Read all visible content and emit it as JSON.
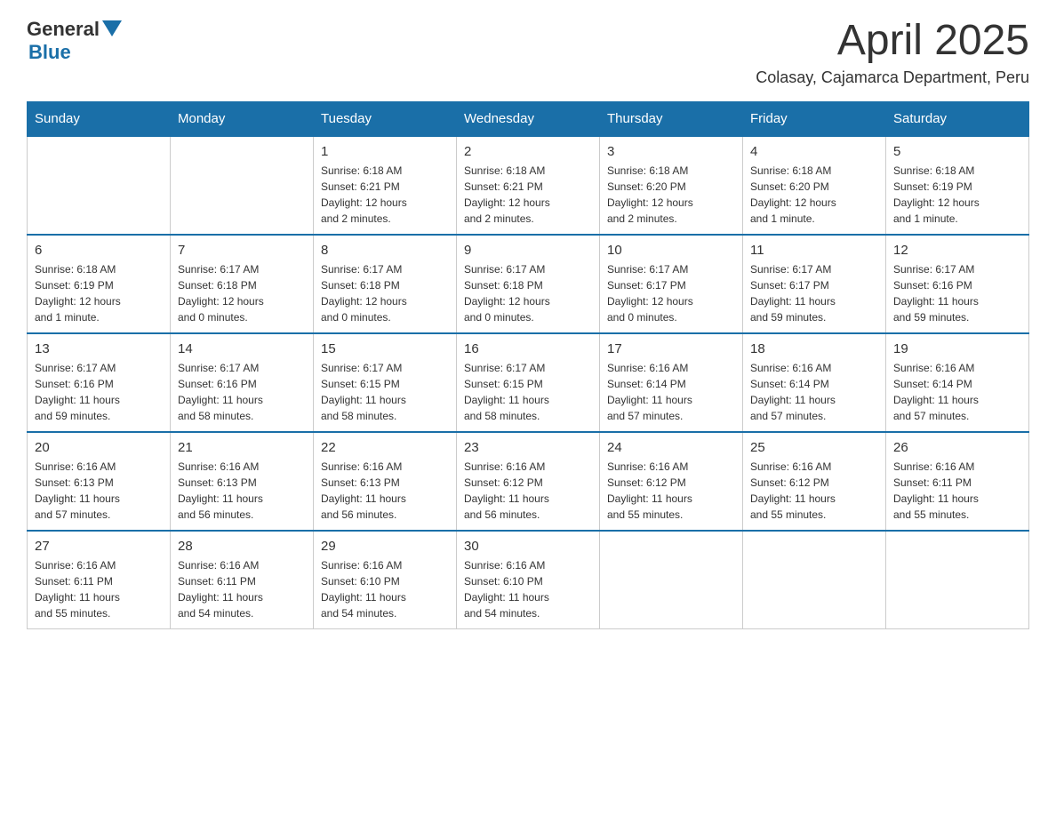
{
  "logo": {
    "text_general": "General",
    "text_blue": "Blue",
    "triangle": "▼"
  },
  "title": "April 2025",
  "subtitle": "Colasay, Cajamarca Department, Peru",
  "days_of_week": [
    "Sunday",
    "Monday",
    "Tuesday",
    "Wednesday",
    "Thursday",
    "Friday",
    "Saturday"
  ],
  "weeks": [
    [
      {
        "day": "",
        "info": ""
      },
      {
        "day": "",
        "info": ""
      },
      {
        "day": "1",
        "info": "Sunrise: 6:18 AM\nSunset: 6:21 PM\nDaylight: 12 hours\nand 2 minutes."
      },
      {
        "day": "2",
        "info": "Sunrise: 6:18 AM\nSunset: 6:21 PM\nDaylight: 12 hours\nand 2 minutes."
      },
      {
        "day": "3",
        "info": "Sunrise: 6:18 AM\nSunset: 6:20 PM\nDaylight: 12 hours\nand 2 minutes."
      },
      {
        "day": "4",
        "info": "Sunrise: 6:18 AM\nSunset: 6:20 PM\nDaylight: 12 hours\nand 1 minute."
      },
      {
        "day": "5",
        "info": "Sunrise: 6:18 AM\nSunset: 6:19 PM\nDaylight: 12 hours\nand 1 minute."
      }
    ],
    [
      {
        "day": "6",
        "info": "Sunrise: 6:18 AM\nSunset: 6:19 PM\nDaylight: 12 hours\nand 1 minute."
      },
      {
        "day": "7",
        "info": "Sunrise: 6:17 AM\nSunset: 6:18 PM\nDaylight: 12 hours\nand 0 minutes."
      },
      {
        "day": "8",
        "info": "Sunrise: 6:17 AM\nSunset: 6:18 PM\nDaylight: 12 hours\nand 0 minutes."
      },
      {
        "day": "9",
        "info": "Sunrise: 6:17 AM\nSunset: 6:18 PM\nDaylight: 12 hours\nand 0 minutes."
      },
      {
        "day": "10",
        "info": "Sunrise: 6:17 AM\nSunset: 6:17 PM\nDaylight: 12 hours\nand 0 minutes."
      },
      {
        "day": "11",
        "info": "Sunrise: 6:17 AM\nSunset: 6:17 PM\nDaylight: 11 hours\nand 59 minutes."
      },
      {
        "day": "12",
        "info": "Sunrise: 6:17 AM\nSunset: 6:16 PM\nDaylight: 11 hours\nand 59 minutes."
      }
    ],
    [
      {
        "day": "13",
        "info": "Sunrise: 6:17 AM\nSunset: 6:16 PM\nDaylight: 11 hours\nand 59 minutes."
      },
      {
        "day": "14",
        "info": "Sunrise: 6:17 AM\nSunset: 6:16 PM\nDaylight: 11 hours\nand 58 minutes."
      },
      {
        "day": "15",
        "info": "Sunrise: 6:17 AM\nSunset: 6:15 PM\nDaylight: 11 hours\nand 58 minutes."
      },
      {
        "day": "16",
        "info": "Sunrise: 6:17 AM\nSunset: 6:15 PM\nDaylight: 11 hours\nand 58 minutes."
      },
      {
        "day": "17",
        "info": "Sunrise: 6:16 AM\nSunset: 6:14 PM\nDaylight: 11 hours\nand 57 minutes."
      },
      {
        "day": "18",
        "info": "Sunrise: 6:16 AM\nSunset: 6:14 PM\nDaylight: 11 hours\nand 57 minutes."
      },
      {
        "day": "19",
        "info": "Sunrise: 6:16 AM\nSunset: 6:14 PM\nDaylight: 11 hours\nand 57 minutes."
      }
    ],
    [
      {
        "day": "20",
        "info": "Sunrise: 6:16 AM\nSunset: 6:13 PM\nDaylight: 11 hours\nand 57 minutes."
      },
      {
        "day": "21",
        "info": "Sunrise: 6:16 AM\nSunset: 6:13 PM\nDaylight: 11 hours\nand 56 minutes."
      },
      {
        "day": "22",
        "info": "Sunrise: 6:16 AM\nSunset: 6:13 PM\nDaylight: 11 hours\nand 56 minutes."
      },
      {
        "day": "23",
        "info": "Sunrise: 6:16 AM\nSunset: 6:12 PM\nDaylight: 11 hours\nand 56 minutes."
      },
      {
        "day": "24",
        "info": "Sunrise: 6:16 AM\nSunset: 6:12 PM\nDaylight: 11 hours\nand 55 minutes."
      },
      {
        "day": "25",
        "info": "Sunrise: 6:16 AM\nSunset: 6:12 PM\nDaylight: 11 hours\nand 55 minutes."
      },
      {
        "day": "26",
        "info": "Sunrise: 6:16 AM\nSunset: 6:11 PM\nDaylight: 11 hours\nand 55 minutes."
      }
    ],
    [
      {
        "day": "27",
        "info": "Sunrise: 6:16 AM\nSunset: 6:11 PM\nDaylight: 11 hours\nand 55 minutes."
      },
      {
        "day": "28",
        "info": "Sunrise: 6:16 AM\nSunset: 6:11 PM\nDaylight: 11 hours\nand 54 minutes."
      },
      {
        "day": "29",
        "info": "Sunrise: 6:16 AM\nSunset: 6:10 PM\nDaylight: 11 hours\nand 54 minutes."
      },
      {
        "day": "30",
        "info": "Sunrise: 6:16 AM\nSunset: 6:10 PM\nDaylight: 11 hours\nand 54 minutes."
      },
      {
        "day": "",
        "info": ""
      },
      {
        "day": "",
        "info": ""
      },
      {
        "day": "",
        "info": ""
      }
    ]
  ]
}
